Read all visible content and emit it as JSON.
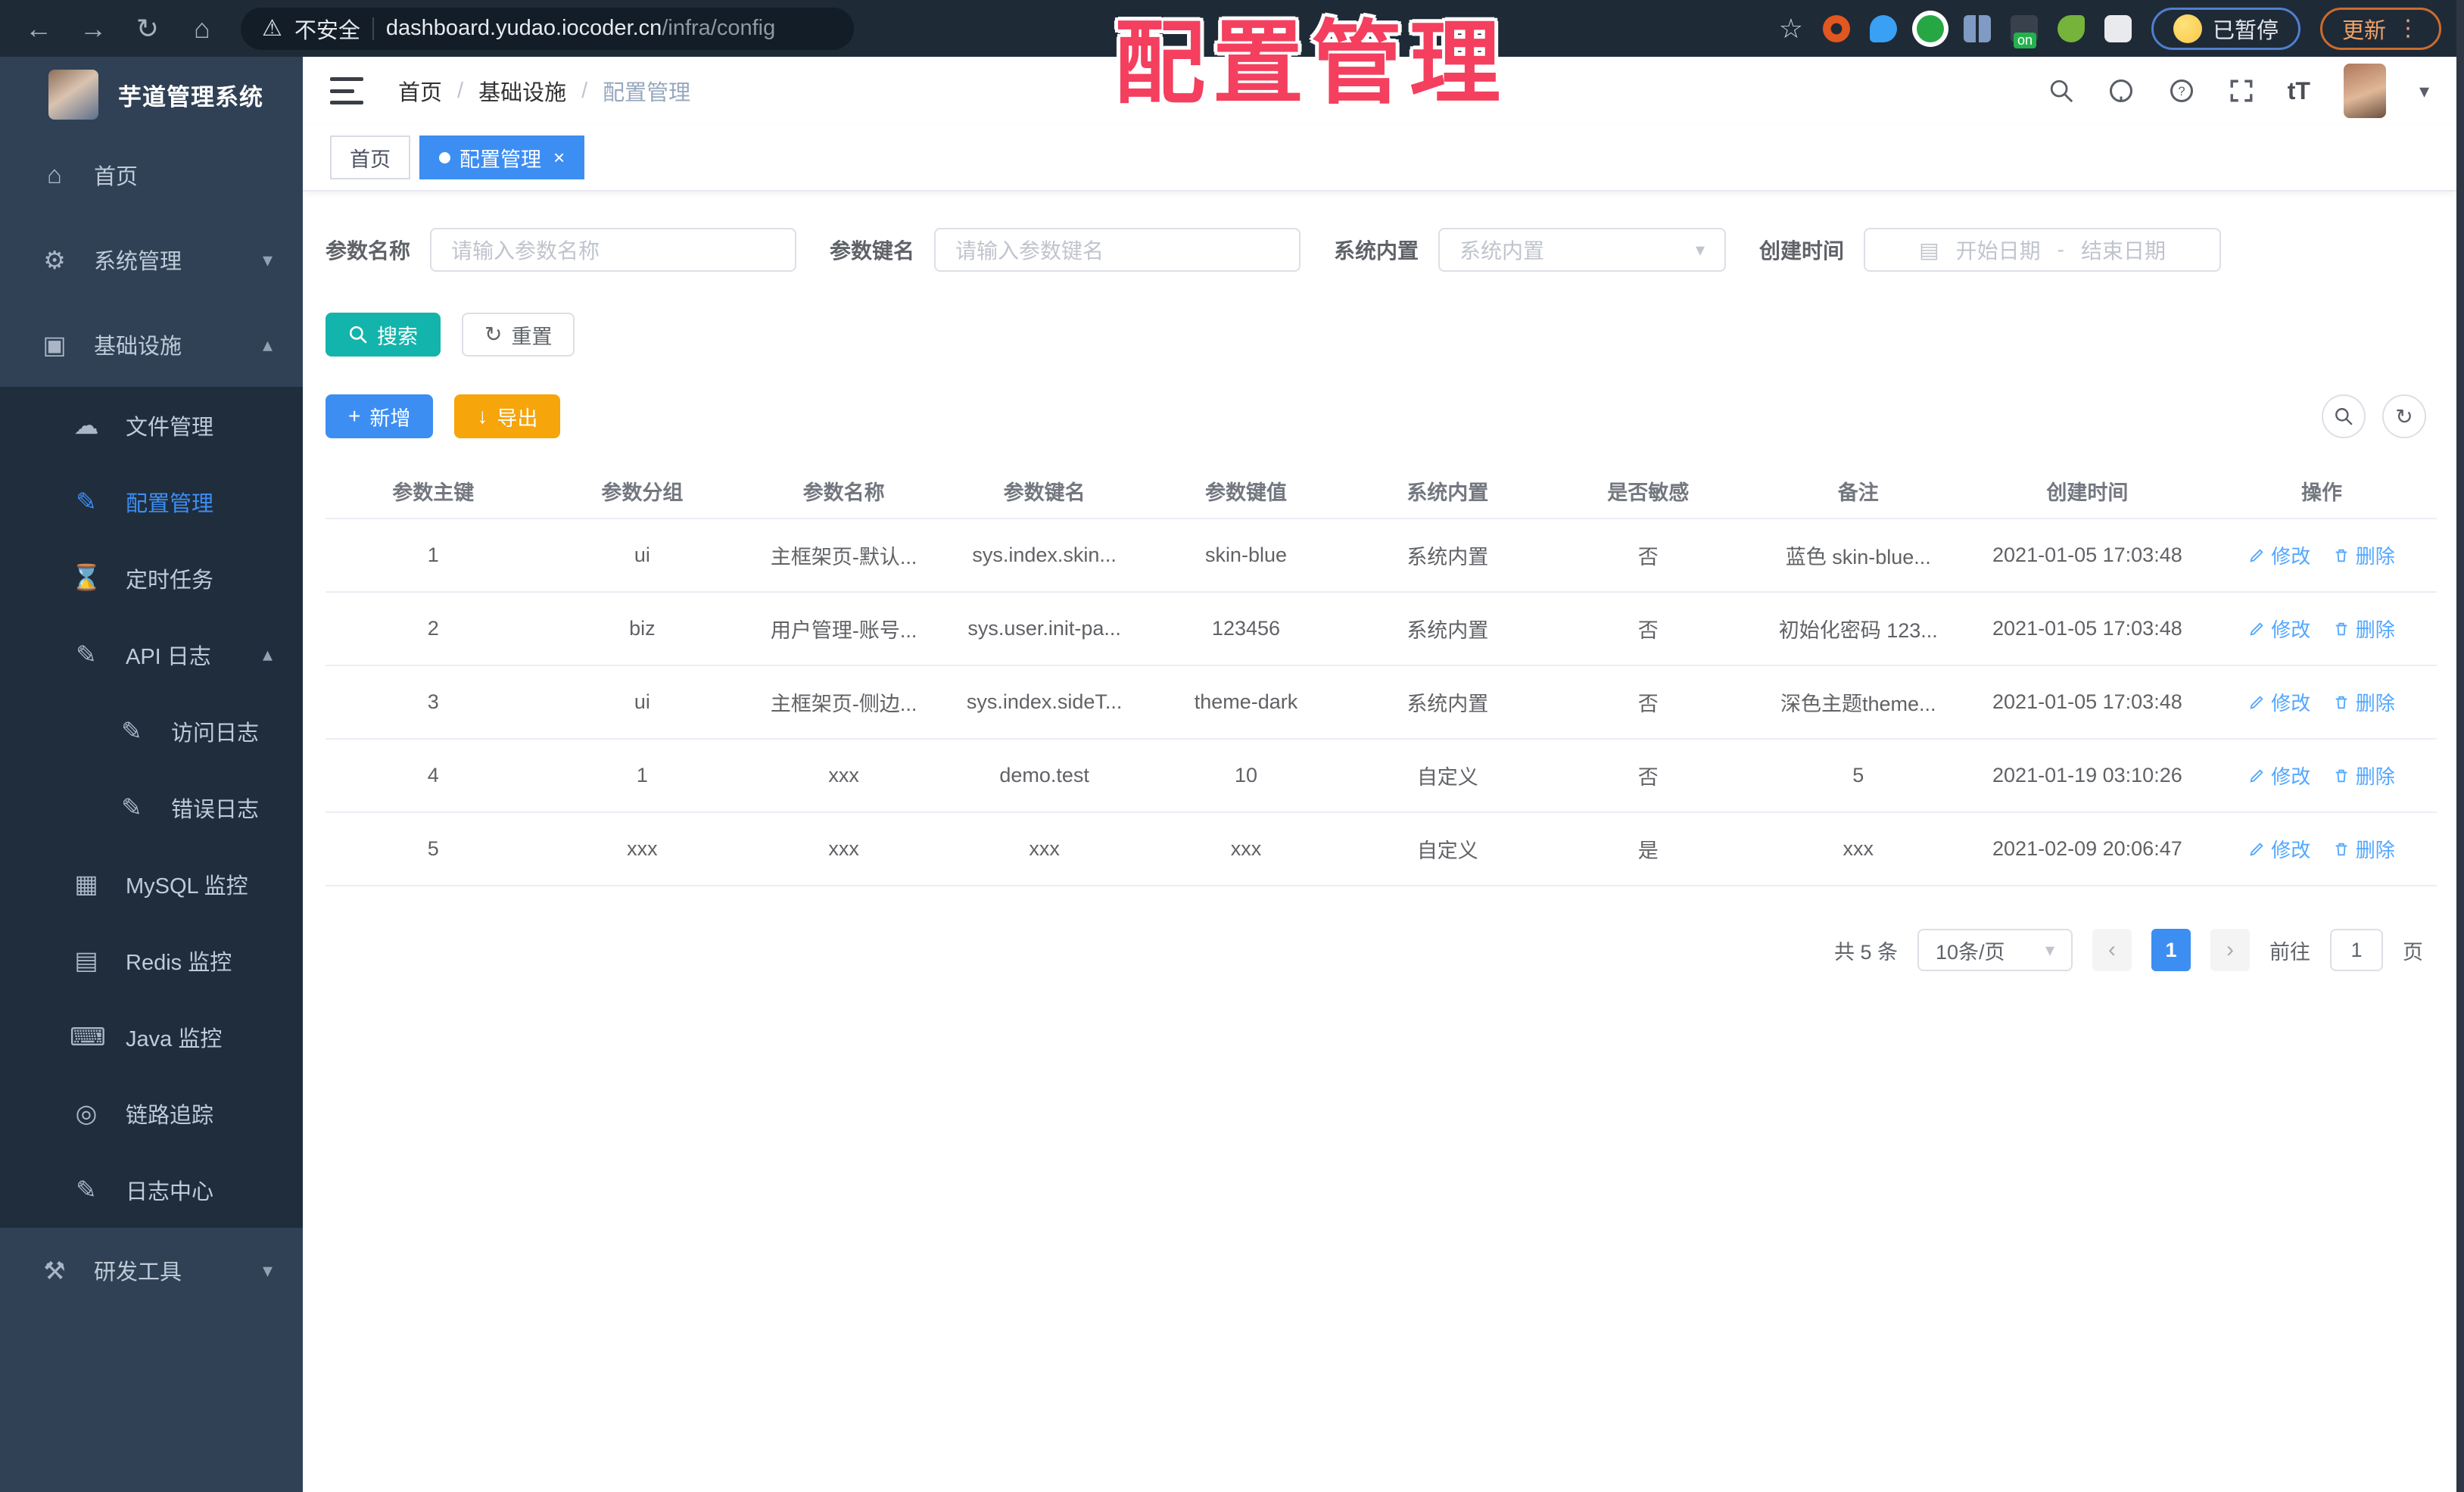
{
  "browser": {
    "security_label": "不安全",
    "url_domain": "dashboard.yudao.iocoder.cn",
    "url_path": "/infra/config",
    "paused_label": "已暂停",
    "update_label": "更新"
  },
  "annotation": {
    "title": "配置管理"
  },
  "sidebar": {
    "app_title": "芋道管理系统",
    "items": [
      {
        "label": "首页"
      },
      {
        "label": "系统管理"
      },
      {
        "label": "基础设施"
      },
      {
        "label": "文件管理"
      },
      {
        "label": "配置管理"
      },
      {
        "label": "定时任务"
      },
      {
        "label": "API 日志"
      },
      {
        "label": "访问日志"
      },
      {
        "label": "错误日志"
      },
      {
        "label": "MySQL 监控"
      },
      {
        "label": "Redis 监控"
      },
      {
        "label": "Java 监控"
      },
      {
        "label": "链路追踪"
      },
      {
        "label": "日志中心"
      },
      {
        "label": "研发工具"
      }
    ]
  },
  "header": {
    "breadcrumb": {
      "home": "首页",
      "section": "基础设施",
      "current": "配置管理"
    }
  },
  "tabs": {
    "home": "首页",
    "current": "配置管理"
  },
  "filters": {
    "name_label": "参数名称",
    "name_placeholder": "请输入参数名称",
    "key_label": "参数键名",
    "key_placeholder": "请输入参数键名",
    "type_label": "系统内置",
    "type_placeholder": "系统内置",
    "date_label": "创建时间",
    "date_start": "开始日期",
    "date_sep": "-",
    "date_end": "结束日期"
  },
  "toolbar": {
    "search": "搜索",
    "reset": "重置",
    "add": "新增",
    "export": "导出"
  },
  "table": {
    "headers": [
      "参数主键",
      "参数分组",
      "参数名称",
      "参数键名",
      "参数键值",
      "系统内置",
      "是否敏感",
      "备注",
      "创建时间",
      "操作"
    ],
    "rows": [
      [
        "1",
        "ui",
        "主框架页-默认...",
        "sys.index.skin...",
        "skin-blue",
        "系统内置",
        "否",
        "蓝色 skin-blue...",
        "2021-01-05 17:03:48"
      ],
      [
        "2",
        "biz",
        "用户管理-账号...",
        "sys.user.init-pa...",
        "123456",
        "系统内置",
        "否",
        "初始化密码 123...",
        "2021-01-05 17:03:48"
      ],
      [
        "3",
        "ui",
        "主框架页-侧边...",
        "sys.index.sideT...",
        "theme-dark",
        "系统内置",
        "否",
        "深色主题theme...",
        "2021-01-05 17:03:48"
      ],
      [
        "4",
        "1",
        "xxx",
        "demo.test",
        "10",
        "自定义",
        "否",
        "5",
        "2021-01-19 03:10:26"
      ],
      [
        "5",
        "xxx",
        "xxx",
        "xxx",
        "xxx",
        "自定义",
        "是",
        "xxx",
        "2021-02-09 20:06:47"
      ]
    ],
    "edit_label": "修改",
    "delete_label": "删除"
  },
  "pagination": {
    "total": "共 5 条",
    "page_size": "10条/页",
    "current_page": "1",
    "goto_label": "前往",
    "goto_value": "1",
    "page_unit": "页"
  },
  "colors": {
    "accent_blue": "#3d8ef2",
    "teal": "#13b4ab",
    "amber": "#f6a50b",
    "annotation_red": "#f43f5f",
    "sidebar_bg": "#304156",
    "submenu_bg": "#1f2d3d",
    "browser_bar_bg": "#1f2a37"
  }
}
